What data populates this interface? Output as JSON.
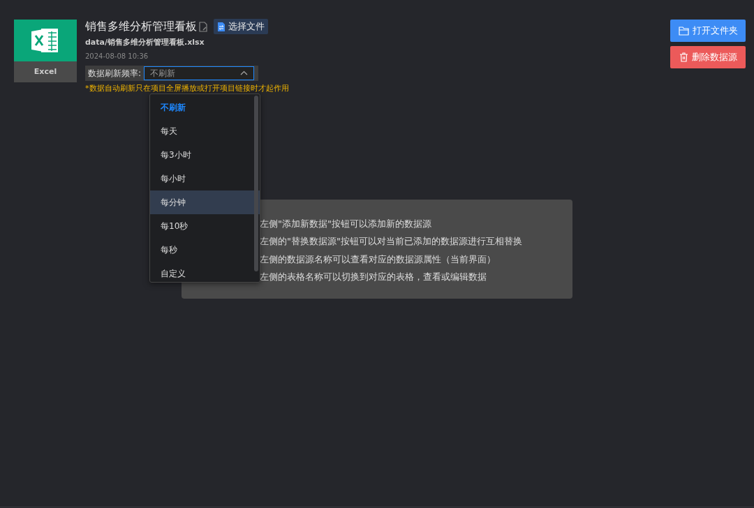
{
  "source": {
    "type_label": "Excel",
    "title": "销售多维分析管理看板",
    "select_button": "选择文件",
    "path": "data/销售多维分析管理看板.xlsx",
    "modified": "2024-08-08 10:36"
  },
  "refresh": {
    "label": "数据刷新频率:",
    "value": "不刷新",
    "expanded": true,
    "note_mark": "*",
    "note": "数据自动刷新只在项目全屏播放或打开项目链接时才起作用"
  },
  "options": [
    {
      "label": "不刷新",
      "selected": true,
      "highlighted": false
    },
    {
      "label": "每天",
      "selected": false,
      "highlighted": false
    },
    {
      "label": "每3小时",
      "selected": false,
      "highlighted": false
    },
    {
      "label": "每小时",
      "selected": false,
      "highlighted": false
    },
    {
      "label": "每分钟",
      "selected": false,
      "highlighted": true
    },
    {
      "label": "每10秒",
      "selected": false,
      "highlighted": false
    },
    {
      "label": "每秒",
      "selected": false,
      "highlighted": false
    },
    {
      "label": "自定义",
      "selected": false,
      "highlighted": false
    }
  ],
  "actions": [
    {
      "label": "打开文件夹",
      "kind": "open"
    },
    {
      "label": "删除数据源",
      "kind": "delete"
    }
  ],
  "help_lines": [
    "左侧\"添加新数据\"按钮可以添加新的数据源",
    "左侧的\"替换数据源\"按钮可以对当前已添加的数据源进行互相替换",
    "左侧的数据源名称可以查看对应的数据源属性（当前界面）",
    "左侧的表格名称可以切换到对应的表格，查看或编辑数据"
  ]
}
